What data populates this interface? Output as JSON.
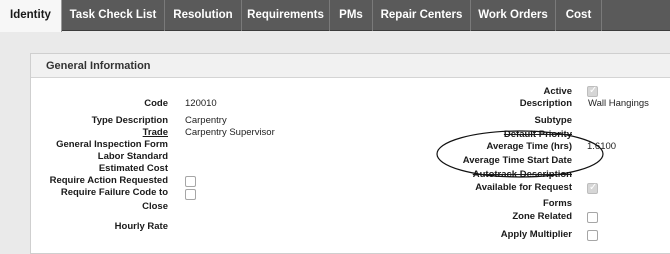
{
  "tabs": [
    {
      "label": "Identity",
      "active": true
    },
    {
      "label": "Task Check List",
      "active": false
    },
    {
      "label": "Resolution",
      "active": false
    },
    {
      "label": "Requirements",
      "active": false
    },
    {
      "label": "PMs",
      "active": false
    },
    {
      "label": "Repair Centers",
      "active": false
    },
    {
      "label": "Work Orders",
      "active": false
    },
    {
      "label": "Cost",
      "active": false
    }
  ],
  "section": {
    "title": "General Information"
  },
  "left_fields": {
    "code": {
      "label": "Code",
      "value": "120010"
    },
    "type_description": {
      "label": "Type Description",
      "value": "Carpentry"
    },
    "trade": {
      "label": "Trade",
      "value": "Carpentry Supervisor"
    },
    "general_inspection_form": {
      "label": "General Inspection Form"
    },
    "labor_standard": {
      "label": "Labor Standard"
    },
    "estimated_cost": {
      "label": "Estimated Cost"
    },
    "require_action_requested": {
      "label": "Require Action Requested",
      "checked": false
    },
    "require_failure_code_to": {
      "label": "Require Failure Code to",
      "checked": false
    },
    "close": {
      "label": "Close"
    },
    "hourly_rate": {
      "label": "Hourly Rate"
    }
  },
  "right_fields": {
    "active": {
      "label": "Active",
      "checked": true
    },
    "description": {
      "label": "Description",
      "value": "Wall Hangings"
    },
    "subtype": {
      "label": "Subtype"
    },
    "default_priority": {
      "label": "Default Priority"
    },
    "average_time": {
      "label": "Average Time (hrs)",
      "value": "1.6100"
    },
    "average_time_start_date": {
      "label": "Average Time Start Date"
    },
    "autotrack_description": {
      "label": "Autotrack Description"
    },
    "available_for_request": {
      "label": "Available for Request",
      "checked": true
    },
    "forms": {
      "label": "Forms"
    },
    "zone_related": {
      "label": "Zone Related",
      "checked": false
    },
    "apply_multiplier": {
      "label": "Apply Multiplier",
      "checked": false
    }
  },
  "colors": {
    "tabbar": "#5a5a5a",
    "active_tab": "#f7f7f7",
    "page_bg": "#eaeaea",
    "panel_bg": "#ffffff"
  }
}
